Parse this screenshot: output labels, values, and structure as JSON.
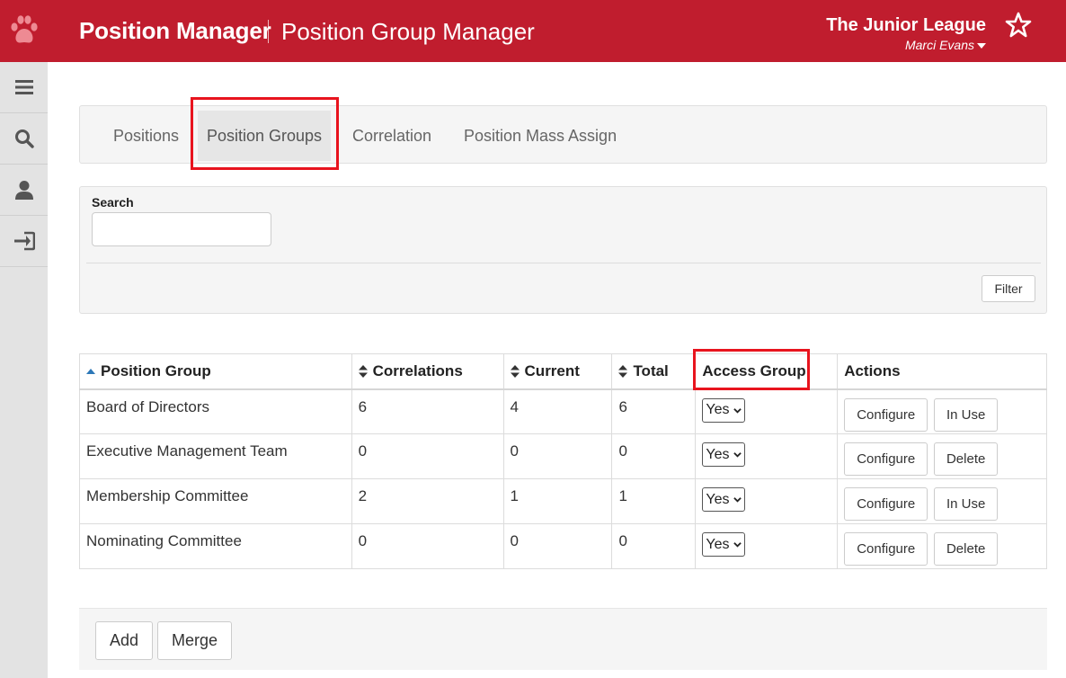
{
  "header": {
    "app_title": "Position Manager",
    "page_title": "Position Group Manager",
    "org_name": "The Junior League",
    "user_name": "Marci Evans"
  },
  "sidebar": {
    "items": [
      {
        "icon": "menu-icon"
      },
      {
        "icon": "search-icon"
      },
      {
        "icon": "user-icon"
      },
      {
        "icon": "logout-icon"
      }
    ]
  },
  "tabs": [
    {
      "label": "Positions",
      "active": false
    },
    {
      "label": "Position Groups",
      "active": true
    },
    {
      "label": "Correlation",
      "active": false
    },
    {
      "label": "Position Mass Assign",
      "active": false
    }
  ],
  "search": {
    "label": "Search",
    "value": "",
    "filter_label": "Filter"
  },
  "table": {
    "columns": [
      {
        "label": "Position Group",
        "sort": "asc"
      },
      {
        "label": "Correlations",
        "sort": "both"
      },
      {
        "label": "Current",
        "sort": "both"
      },
      {
        "label": "Total",
        "sort": "both"
      },
      {
        "label": "Access Group",
        "sort": "none"
      },
      {
        "label": "Actions",
        "sort": "none"
      }
    ],
    "rows": [
      {
        "name": "Board of Directors",
        "correlations": "6",
        "current": "4",
        "total": "6",
        "access": "Yes",
        "configure": "Configure",
        "action2": "In Use"
      },
      {
        "name": "Executive Management Team",
        "correlations": "0",
        "current": "0",
        "total": "0",
        "access": "Yes",
        "configure": "Configure",
        "action2": "Delete"
      },
      {
        "name": "Membership Committee",
        "correlations": "2",
        "current": "1",
        "total": "1",
        "access": "Yes",
        "configure": "Configure",
        "action2": "In Use"
      },
      {
        "name": "Nominating Committee",
        "correlations": "0",
        "current": "0",
        "total": "0",
        "access": "Yes",
        "configure": "Configure",
        "action2": "Delete"
      }
    ]
  },
  "footer": {
    "add_label": "Add",
    "merge_label": "Merge"
  },
  "colors": {
    "brand": "#c01d2e",
    "link": "#2d78b8",
    "highlight": "#e8141e"
  }
}
